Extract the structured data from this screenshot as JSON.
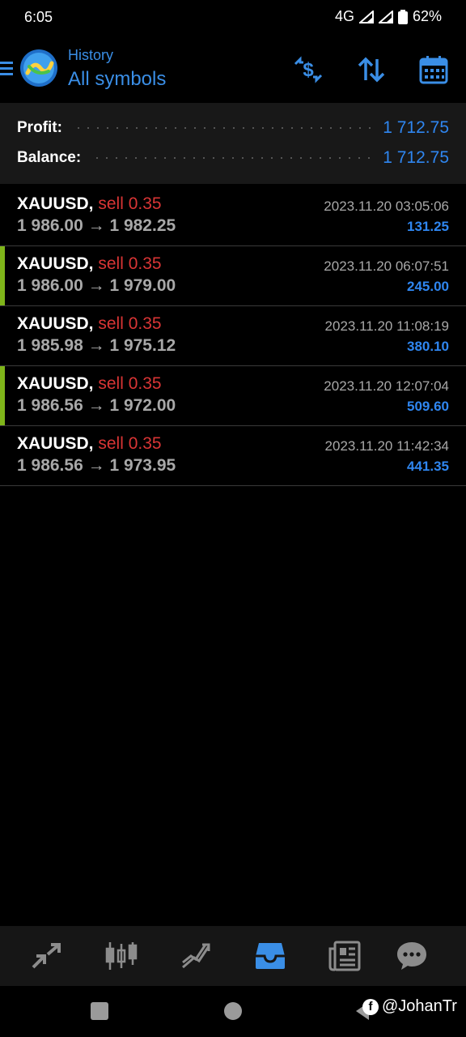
{
  "status_bar": {
    "time": "6:05",
    "network": "4G",
    "battery": "62%"
  },
  "header": {
    "subtitle": "History",
    "title": "All symbols",
    "icons": [
      "menu-icon",
      "metatrader-logo",
      "deposit-currency-icon",
      "sort-icon",
      "calendar-icon"
    ],
    "accent_color": "#3a8ee6"
  },
  "summary": {
    "profit_label": "Profit:",
    "profit_value": "1 712.75",
    "balance_label": "Balance:",
    "balance_value": "1 712.75"
  },
  "deals": [
    {
      "symbol": "XAUUSD,",
      "type": "sell 0.35",
      "open_price": "1 986.00",
      "arrow": "→",
      "close_price": "1 982.25",
      "time": "2023.11.20 03:05:06",
      "profit": "131.25",
      "accent": false
    },
    {
      "symbol": "XAUUSD,",
      "type": "sell 0.35",
      "open_price": "1 986.00",
      "arrow": "→",
      "close_price": "1 979.00",
      "time": "2023.11.20 06:07:51",
      "profit": "245.00",
      "accent": true
    },
    {
      "symbol": "XAUUSD,",
      "type": "sell 0.35",
      "open_price": "1 985.98",
      "arrow": "→",
      "close_price": "1 975.12",
      "time": "2023.11.20 11:08:19",
      "profit": "380.10",
      "accent": false
    },
    {
      "symbol": "XAUUSD,",
      "type": "sell 0.35",
      "open_price": "1 986.56",
      "arrow": "→",
      "close_price": "1 972.00",
      "time": "2023.11.20 12:07:04",
      "profit": "509.60",
      "accent": true
    },
    {
      "symbol": "XAUUSD,",
      "type": "sell 0.35",
      "open_price": "1 986.56",
      "arrow": "→",
      "close_price": "1 973.95",
      "time": "2023.11.20 11:42:34",
      "profit": "441.35",
      "accent": false
    }
  ],
  "colors": {
    "profit_blue": "#2f86f0",
    "sell_red": "#d93535",
    "accent_green": "#7fb51a",
    "active_nav": "#3a8ee6"
  },
  "bottom_nav": {
    "items": [
      "quotes-icon",
      "chart-icon",
      "trade-icon",
      "history-icon",
      "news-icon",
      "chat-icon"
    ],
    "active": "history-icon"
  },
  "watermark": {
    "text": "@JohanTr"
  }
}
